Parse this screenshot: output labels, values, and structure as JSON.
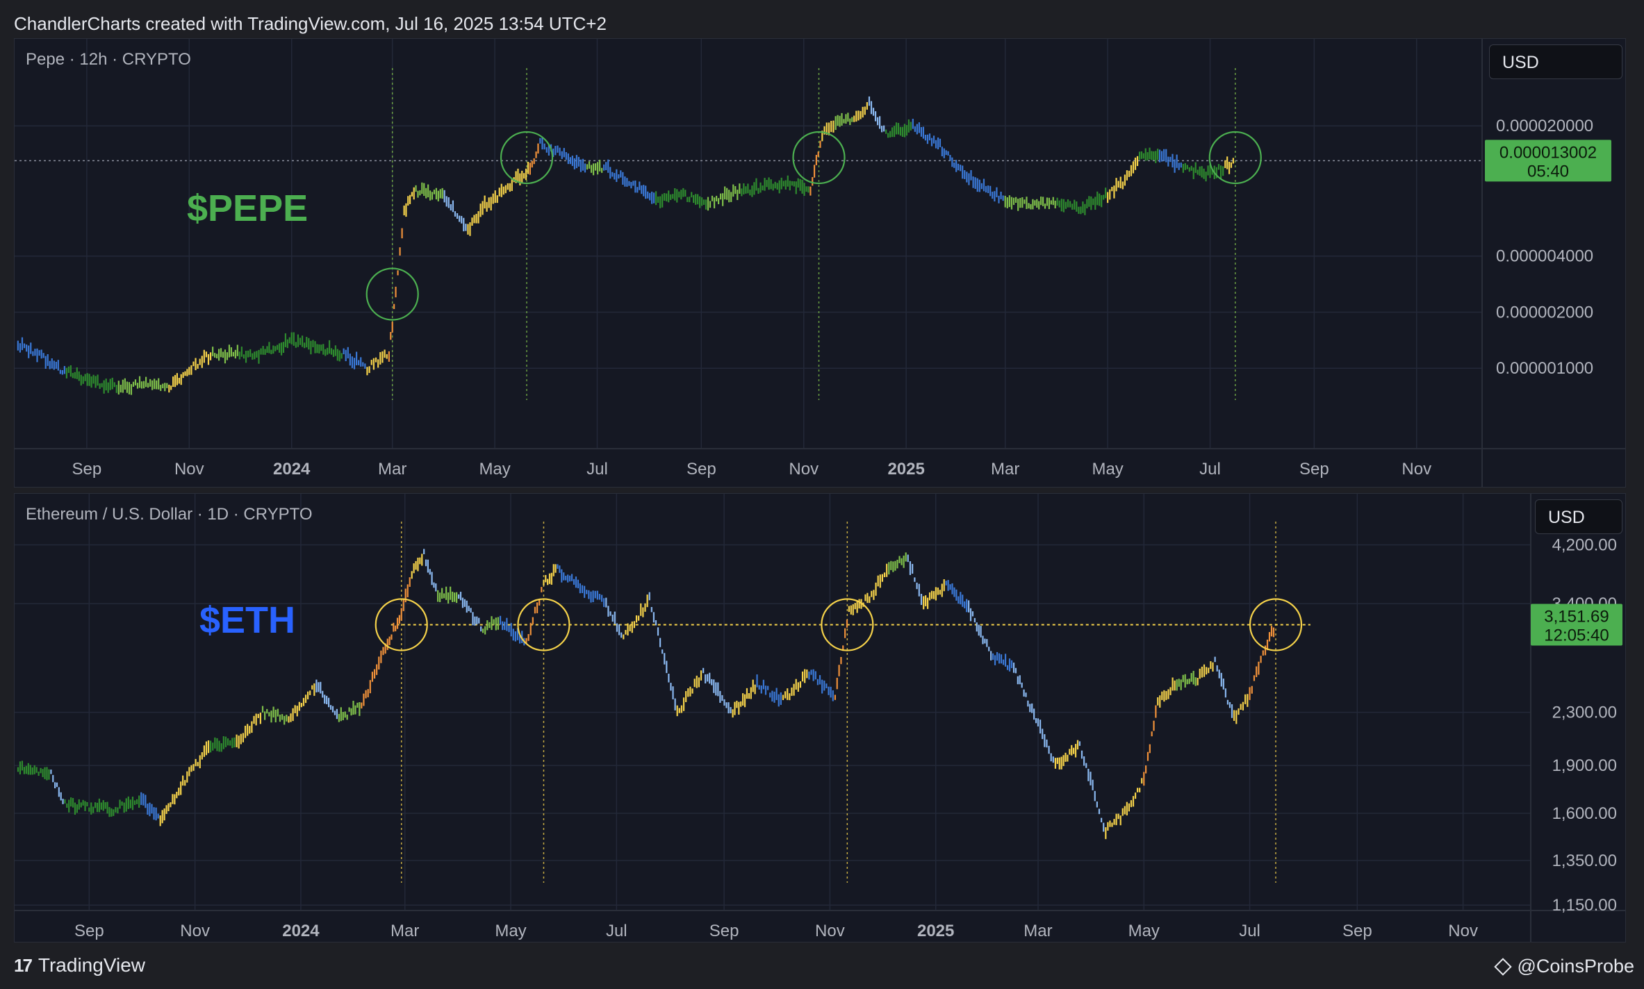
{
  "header": {
    "text": "ChandlerCharts created with TradingView.com, Jul 16, 2025 13:54 UTC+2"
  },
  "footer": {
    "brand": "TradingView",
    "watermark": "@CoinsProbe"
  },
  "colors": {
    "panel_bg": "#151823",
    "grid": "#232838",
    "text": "#b2b5be",
    "green": "#2e8b2e",
    "lightgreen": "#7fc04a",
    "yellow": "#f5d24a",
    "orange": "#f0913a",
    "red": "#e0533a",
    "blue": "#3a78d6",
    "lightblue": "#8ab8f0",
    "price_tag_bg": "#4caf50",
    "pepe_title": "#4caf50",
    "eth_title": "#2962ff",
    "circle_pepe": "#4caf50",
    "circle_eth": "#f5d24a"
  },
  "chart_data": [
    {
      "type": "line",
      "symbol_label": "Pepe · 12h · CRYPTO",
      "title": "$PEPE",
      "currency": "USD",
      "scale": "log",
      "y_ticks": [
        "0.000020000",
        "0.000004000",
        "0.000002000",
        "0.000001000"
      ],
      "y_tick_values": [
        2e-05,
        4e-06,
        2e-06,
        1e-06
      ],
      "last_price": "0.000013002",
      "countdown": "05:40",
      "x_ticks": [
        "Sep",
        "Nov",
        "2024",
        "Mar",
        "May",
        "Jul",
        "Sep",
        "Nov",
        "2025",
        "Mar",
        "May",
        "Jul",
        "Sep",
        "Nov"
      ],
      "x_tick_dates": [
        "2023-09-01",
        "2023-11-01",
        "2024-01-01",
        "2024-03-01",
        "2024-05-01",
        "2024-07-01",
        "2024-09-01",
        "2024-11-01",
        "2025-01-01",
        "2025-03-01",
        "2025-05-01",
        "2025-07-01",
        "2025-09-01",
        "2025-11-01"
      ],
      "x_range": [
        "2023-07-20",
        "2025-12-10"
      ],
      "y_range": [
        5e-07,
        3.5e-05
      ],
      "series": [
        {
          "points": [
            [
              "2023-07-22",
              1.35e-06
            ],
            [
              "2023-08-05",
              1.15e-06
            ],
            [
              "2023-08-20",
              9.5e-07
            ],
            [
              "2023-09-05",
              8.5e-07
            ],
            [
              "2023-09-20",
              7.8e-07
            ],
            [
              "2023-10-05",
              8.2e-07
            ],
            [
              "2023-10-20",
              7.8e-07
            ],
            [
              "2023-11-01",
              1e-06
            ],
            [
              "2023-11-15",
              1.2e-06
            ],
            [
              "2023-12-01",
              1.2e-06
            ],
            [
              "2023-12-15",
              1.2e-06
            ],
            [
              "2024-01-01",
              1.4e-06
            ],
            [
              "2024-01-15",
              1.3e-06
            ],
            [
              "2024-02-01",
              1.2e-06
            ],
            [
              "2024-02-15",
              1e-06
            ],
            [
              "2024-02-28",
              1.2e-06
            ],
            [
              "2024-03-03",
              2.5e-06
            ],
            [
              "2024-03-08",
              7e-06
            ],
            [
              "2024-03-15",
              9e-06
            ],
            [
              "2024-04-01",
              8.5e-06
            ],
            [
              "2024-04-15",
              5.5e-06
            ],
            [
              "2024-04-25",
              7.5e-06
            ],
            [
              "2024-05-10",
              9.5e-06
            ],
            [
              "2024-05-22",
              1.2e-05
            ],
            [
              "2024-05-28",
              1.6e-05
            ],
            [
              "2024-06-10",
              1.4e-05
            ],
            [
              "2024-06-25",
              1.2e-05
            ],
            [
              "2024-07-05",
              1.2e-05
            ],
            [
              "2024-07-20",
              1e-05
            ],
            [
              "2024-08-05",
              8e-06
            ],
            [
              "2024-08-20",
              8.5e-06
            ],
            [
              "2024-09-05",
              7.8e-06
            ],
            [
              "2024-09-25",
              9e-06
            ],
            [
              "2024-10-10",
              9.5e-06
            ],
            [
              "2024-10-25",
              9.8e-06
            ],
            [
              "2024-11-05",
              9e-06
            ],
            [
              "2024-11-12",
              1.8e-05
            ],
            [
              "2024-11-20",
              2.1e-05
            ],
            [
              "2024-12-01",
              2.2e-05
            ],
            [
              "2024-12-10",
              2.6e-05
            ],
            [
              "2024-12-20",
              1.8e-05
            ],
            [
              "2025-01-05",
              2e-05
            ],
            [
              "2025-01-20",
              1.6e-05
            ],
            [
              "2025-02-01",
              1.2e-05
            ],
            [
              "2025-02-15",
              9.5e-06
            ],
            [
              "2025-03-01",
              8e-06
            ],
            [
              "2025-03-15",
              7.5e-06
            ],
            [
              "2025-04-01",
              7.8e-06
            ],
            [
              "2025-04-15",
              7.2e-06
            ],
            [
              "2025-05-01",
              8.5e-06
            ],
            [
              "2025-05-10",
              1e-05
            ],
            [
              "2025-05-20",
              1.4e-05
            ],
            [
              "2025-06-01",
              1.4e-05
            ],
            [
              "2025-06-15",
              1.2e-05
            ],
            [
              "2025-07-01",
              1.1e-05
            ],
            [
              "2025-07-10",
              1.2e-05
            ],
            [
              "2025-07-16",
              1.3e-05
            ]
          ]
        }
      ],
      "annotations": [
        {
          "kind": "circle",
          "x": "2024-03-01",
          "y": 2.5e-06
        },
        {
          "kind": "circle",
          "x": "2024-05-20",
          "y": 1.35e-05
        },
        {
          "kind": "circle",
          "x": "2024-11-10",
          "y": 1.35e-05
        },
        {
          "kind": "circle",
          "x": "2025-07-16",
          "y": 1.35e-05
        }
      ],
      "vlines": [
        "2024-03-01",
        "2024-05-20",
        "2024-11-10",
        "2025-07-16"
      ]
    },
    {
      "type": "line",
      "symbol_label": "Ethereum / U.S. Dollar · 1D · CRYPTO",
      "title": "$ETH",
      "currency": "USD",
      "scale": "log",
      "y_ticks": [
        "4,200.00",
        "3,400.00",
        "2,300.00",
        "1,900.00",
        "1,600.00",
        "1,350.00",
        "1,150.00"
      ],
      "y_tick_values": [
        4200,
        3400,
        2300,
        1900,
        1600,
        1350,
        1150
      ],
      "last_price": "3,151.69",
      "countdown": "12:05:40",
      "x_ticks": [
        "Sep",
        "Nov",
        "2024",
        "Mar",
        "May",
        "Jul",
        "Sep",
        "Nov",
        "2025",
        "Mar",
        "May",
        "Jul",
        "Sep",
        "Nov"
      ],
      "x_tick_dates": [
        "2023-09-01",
        "2023-11-01",
        "2024-01-01",
        "2024-03-01",
        "2024-05-01",
        "2024-07-01",
        "2024-09-01",
        "2024-11-01",
        "2025-01-01",
        "2025-03-01",
        "2025-05-01",
        "2025-07-01",
        "2025-09-01",
        "2025-11-01"
      ],
      "x_range": [
        "2023-07-20",
        "2025-12-10"
      ],
      "y_range": [
        1100,
        4800
      ],
      "hline": 3151.69,
      "series": [
        {
          "points": [
            [
              "2023-07-22",
              1880
            ],
            [
              "2023-08-10",
              1850
            ],
            [
              "2023-08-18",
              1650
            ],
            [
              "2023-09-01",
              1640
            ],
            [
              "2023-09-15",
              1620
            ],
            [
              "2023-10-01",
              1680
            ],
            [
              "2023-10-12",
              1560
            ],
            [
              "2023-10-25",
              1780
            ],
            [
              "2023-11-10",
              2050
            ],
            [
              "2023-11-25",
              2050
            ],
            [
              "2023-12-10",
              2300
            ],
            [
              "2023-12-25",
              2250
            ],
            [
              "2024-01-10",
              2550
            ],
            [
              "2024-01-23",
              2250
            ],
            [
              "2024-02-05",
              2350
            ],
            [
              "2024-02-20",
              2950
            ],
            [
              "2024-02-28",
              3300
            ],
            [
              "2024-03-05",
              3800
            ],
            [
              "2024-03-12",
              4050
            ],
            [
              "2024-03-20",
              3500
            ],
            [
              "2024-04-01",
              3500
            ],
            [
              "2024-04-15",
              3100
            ],
            [
              "2024-04-25",
              3200
            ],
            [
              "2024-05-10",
              2950
            ],
            [
              "2024-05-20",
              3650
            ],
            [
              "2024-05-28",
              3850
            ],
            [
              "2024-06-10",
              3600
            ],
            [
              "2024-06-25",
              3400
            ],
            [
              "2024-07-05",
              3000
            ],
            [
              "2024-07-20",
              3450
            ],
            [
              "2024-08-05",
              2300
            ],
            [
              "2024-08-20",
              2650
            ],
            [
              "2024-09-06",
              2300
            ],
            [
              "2024-09-20",
              2550
            ],
            [
              "2024-10-05",
              2400
            ],
            [
              "2024-10-20",
              2650
            ],
            [
              "2024-11-04",
              2450
            ],
            [
              "2024-11-12",
              3300
            ],
            [
              "2024-11-25",
              3500
            ],
            [
              "2024-12-05",
              3900
            ],
            [
              "2024-12-16",
              4000
            ],
            [
              "2024-12-25",
              3400
            ],
            [
              "2025-01-07",
              3650
            ],
            [
              "2025-01-20",
              3350
            ],
            [
              "2025-02-03",
              2800
            ],
            [
              "2025-02-15",
              2700
            ],
            [
              "2025-03-01",
              2200
            ],
            [
              "2025-03-11",
              1900
            ],
            [
              "2025-03-25",
              2050
            ],
            [
              "2025-04-09",
              1500
            ],
            [
              "2025-04-20",
              1600
            ],
            [
              "2025-05-01",
              1800
            ],
            [
              "2025-05-09",
              2400
            ],
            [
              "2025-05-20",
              2550
            ],
            [
              "2025-06-01",
              2600
            ],
            [
              "2025-06-11",
              2750
            ],
            [
              "2025-06-22",
              2250
            ],
            [
              "2025-07-01",
              2450
            ],
            [
              "2025-07-10",
              2900
            ],
            [
              "2025-07-16",
              3150
            ]
          ]
        }
      ],
      "annotations": [
        {
          "kind": "circle",
          "x": "2024-02-28",
          "y": 3151.69
        },
        {
          "kind": "circle",
          "x": "2024-05-20",
          "y": 3151.69
        },
        {
          "kind": "circle",
          "x": "2024-11-11",
          "y": 3151.69
        },
        {
          "kind": "circle",
          "x": "2025-07-16",
          "y": 3151.69
        }
      ],
      "vlines": [
        "2024-02-28",
        "2024-05-20",
        "2024-11-11",
        "2025-07-16"
      ]
    }
  ]
}
